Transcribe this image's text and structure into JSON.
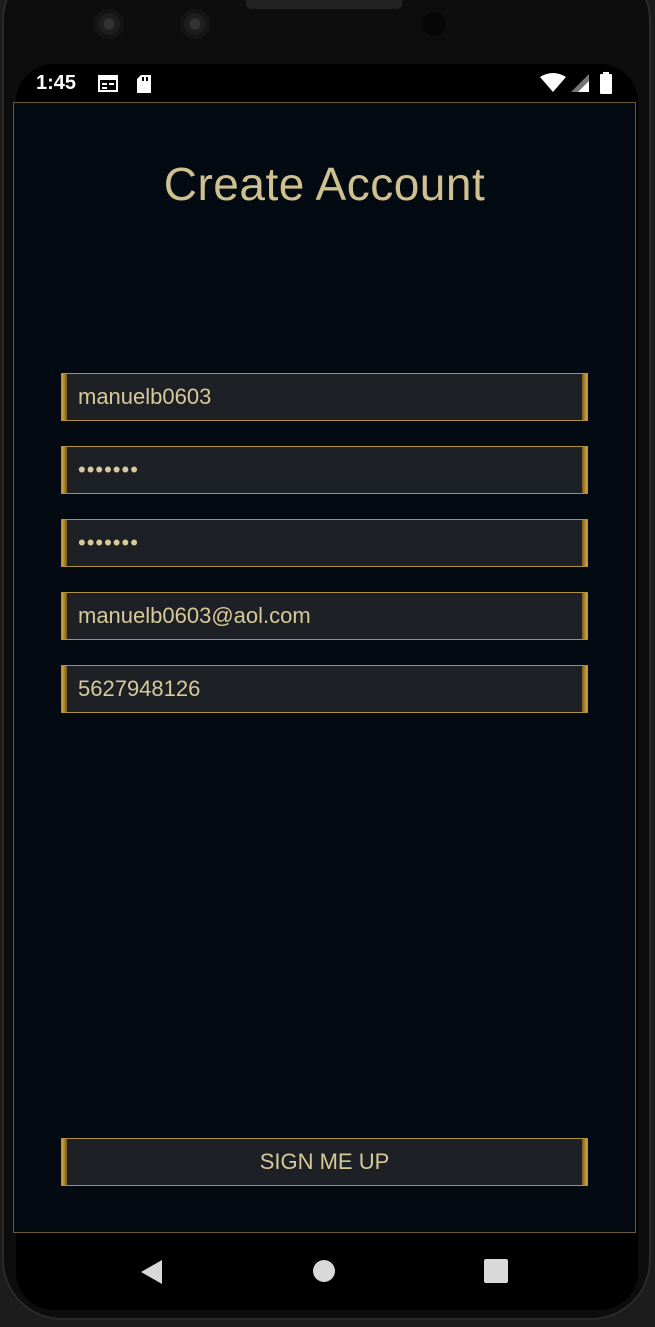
{
  "status_bar": {
    "time": "1:45",
    "icons": [
      "calendar-notification-icon",
      "sd-card-icon",
      "wifi-icon",
      "cell-signal-icon",
      "battery-icon"
    ]
  },
  "screen": {
    "title": "Create Account",
    "fields": {
      "username": "manuelb0603",
      "password": "•••••••",
      "confirm_password": "•••••••",
      "email": "manuelb0603@aol.com",
      "phone": "5627948126"
    },
    "signup_label": "SIGN ME UP"
  },
  "nav_bar": {
    "buttons": [
      "back-icon",
      "home-icon",
      "recents-icon"
    ]
  },
  "colors": {
    "accent_gold": "#cfc08f",
    "border_gold": "#b0913f",
    "screen_background": "#040a12",
    "field_background": "#1d2025"
  }
}
